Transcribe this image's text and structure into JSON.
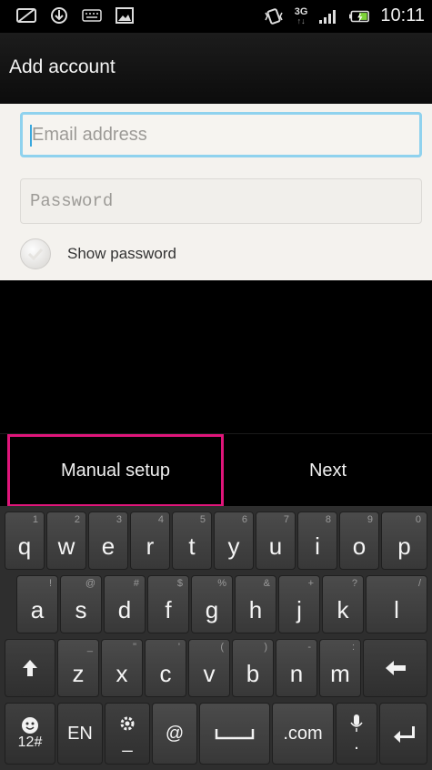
{
  "status_bar": {
    "network_type": "3G",
    "time": "10:11"
  },
  "title_bar": {
    "title": "Add account"
  },
  "form": {
    "email": {
      "value": "",
      "placeholder": "Email address"
    },
    "password": {
      "value": "",
      "placeholder": "Password"
    },
    "show_password": {
      "label": "Show password",
      "checked": false
    }
  },
  "actions": {
    "manual_setup": "Manual setup",
    "next": "Next"
  },
  "keyboard": {
    "row1": [
      {
        "key": "q",
        "alt": "1"
      },
      {
        "key": "w",
        "alt": "2"
      },
      {
        "key": "e",
        "alt": "3"
      },
      {
        "key": "r",
        "alt": "4"
      },
      {
        "key": "t",
        "alt": "5"
      },
      {
        "key": "y",
        "alt": "6"
      },
      {
        "key": "u",
        "alt": "7"
      },
      {
        "key": "i",
        "alt": "8"
      },
      {
        "key": "o",
        "alt": "9"
      },
      {
        "key": "p",
        "alt": "0"
      }
    ],
    "row2": [
      {
        "key": "a",
        "alt": "!"
      },
      {
        "key": "s",
        "alt": "@"
      },
      {
        "key": "d",
        "alt": "#"
      },
      {
        "key": "f",
        "alt": "$"
      },
      {
        "key": "g",
        "alt": "%"
      },
      {
        "key": "h",
        "alt": "&"
      },
      {
        "key": "j",
        "alt": "+"
      },
      {
        "key": "k",
        "alt": "?"
      },
      {
        "key": "l",
        "alt": "/"
      }
    ],
    "row3": [
      {
        "key": "z",
        "alt": "_"
      },
      {
        "key": "x",
        "alt": "\""
      },
      {
        "key": "c",
        "alt": "'"
      },
      {
        "key": "v",
        "alt": "("
      },
      {
        "key": "b",
        "alt": ")"
      },
      {
        "key": "n",
        "alt": "-"
      },
      {
        "key": "m",
        "alt": ":"
      }
    ],
    "row4": {
      "symbols": "12#",
      "language": "EN",
      "settings_sub": "_",
      "at": "@",
      "dotcom": ".com",
      "mic_sub": "."
    }
  }
}
